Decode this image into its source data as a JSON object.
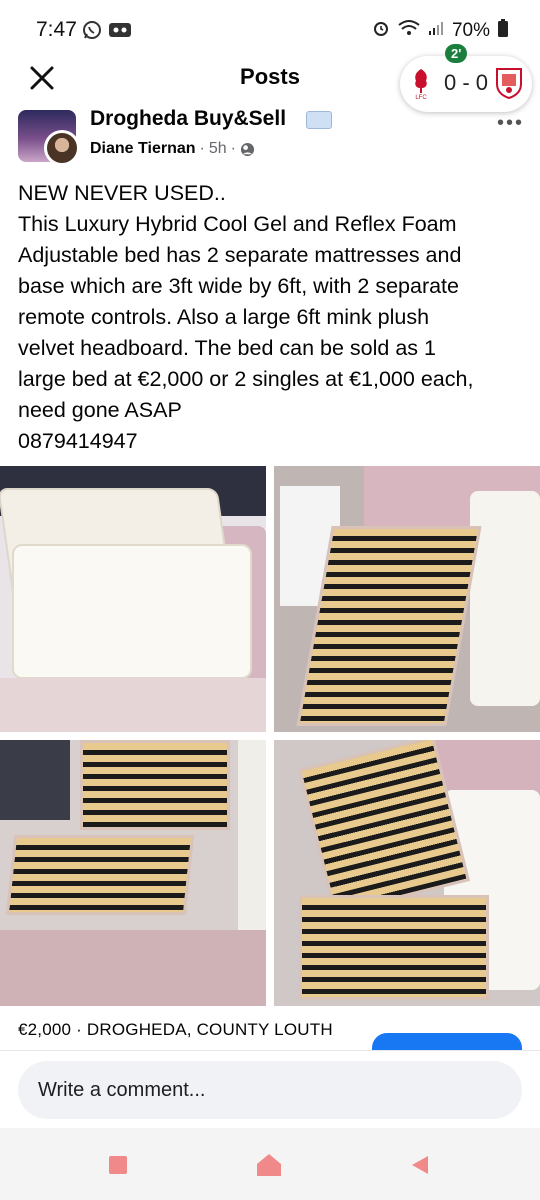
{
  "status_bar": {
    "time": "7:47",
    "battery": "70%",
    "left_icons": [
      "whatsapp-icon",
      "voicemail-icon"
    ],
    "right_icons": [
      "alarm-icon",
      "wifi-icon",
      "signal-icon",
      "battery-icon"
    ]
  },
  "header": {
    "title": "Posts",
    "close_icon": "close-icon"
  },
  "score_widget": {
    "minute": "2'",
    "score": "0 - 0",
    "home_crest_icon": "liverpool-crest-icon",
    "away_crest_icon": "barnsley-crest-icon"
  },
  "post": {
    "group_name": "Drogheda Buy&Sell",
    "poster": "Diane Tiernan",
    "time": "5h",
    "separator": "·",
    "audience_icon": "public-globe-icon",
    "lines": [
      "NEW NEVER USED..",
      "This Luxury Hybrid Cool Gel and Reflex Foam",
      "Adjustable bed has 2 separate mattresses and",
      "base which are 3ft wide by 6ft, with 2 separate",
      "remote controls. Also a large 6ft mink plush",
      "velvet headboard. The bed can be sold as 1",
      "large bed at €2,000 or 2 singles at €1,000 each,",
      "need gone ASAP",
      "0879414947"
    ],
    "more_icon": "more-dots-icon"
  },
  "listing": {
    "price_location": "€2,000 · DROGHEDA, COUNTY LOUTH"
  },
  "comment": {
    "placeholder": "Write a comment..."
  },
  "nav": {
    "recent_icon": "recent-apps-icon",
    "home_icon": "home-icon",
    "back_icon": "back-icon"
  },
  "colors": {
    "accent": "#1877f2",
    "live_green": "#1a7f3c",
    "nav_pink": "#f08a8a"
  }
}
